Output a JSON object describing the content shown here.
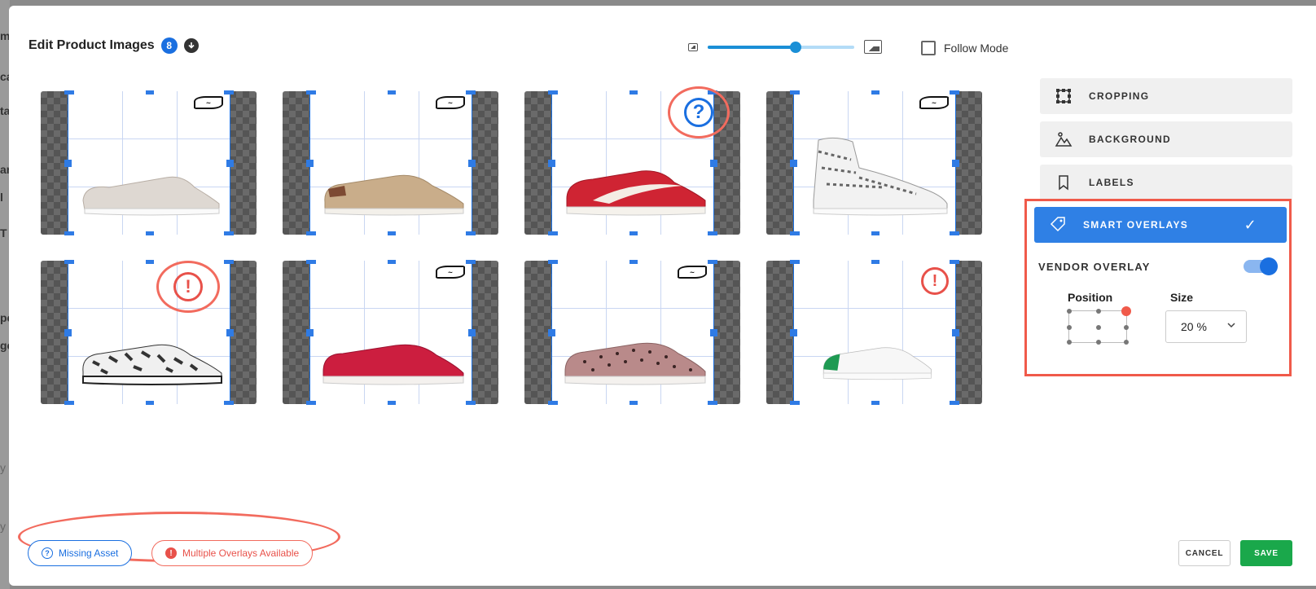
{
  "header": {
    "title": "Edit Product Images",
    "image_count": "8"
  },
  "zoom": {
    "value": 0.6
  },
  "follow_mode": {
    "label": "Follow Mode",
    "checked": false
  },
  "background_page": {
    "fragments": [
      "m",
      "ca",
      "ta",
      "ar",
      "l",
      "T",
      "pe",
      "ge",
      "y",
      "y"
    ]
  },
  "cards": [
    {
      "shoe": "slip-on",
      "overlay": "vans-logo",
      "marker": ""
    },
    {
      "shoe": "era-tan",
      "overlay": "vans-logo",
      "marker": ""
    },
    {
      "shoe": "suede-red",
      "overlay": "",
      "marker": "?"
    },
    {
      "shoe": "high-top-white",
      "overlay": "vans-logo",
      "marker": ""
    },
    {
      "shoe": "print-white",
      "overlay": "",
      "marker": "!"
    },
    {
      "shoe": "authentic-red",
      "overlay": "vans-logo",
      "marker": ""
    },
    {
      "shoe": "dotted-pink",
      "overlay": "vans-logo",
      "marker": ""
    },
    {
      "shoe": "stan-smith",
      "overlay": "",
      "marker": "!"
    }
  ],
  "panel": {
    "items": [
      {
        "label": "CROPPING",
        "icon": "crop-icon"
      },
      {
        "label": "BACKGROUND",
        "icon": "background-icon"
      },
      {
        "label": "LABELS",
        "icon": "bookmark-icon"
      }
    ],
    "smart_overlays": {
      "label": "SMART OVERLAYS",
      "icon": "tag-icon"
    },
    "vendor_overlay": {
      "label": "VENDOR OVERLAY",
      "enabled": true
    },
    "position": {
      "label": "Position",
      "selected": "top-right"
    },
    "size": {
      "label": "Size",
      "value": "20 %"
    }
  },
  "footer": {
    "missing_asset": "Missing Asset",
    "multiple_overlays": "Multiple Overlays Available",
    "cancel": "CANCEL",
    "save": "SAVE"
  },
  "colors": {
    "primary": "#2f80e5",
    "accent_red": "#f26b5e",
    "save_green": "#1aa84b"
  }
}
